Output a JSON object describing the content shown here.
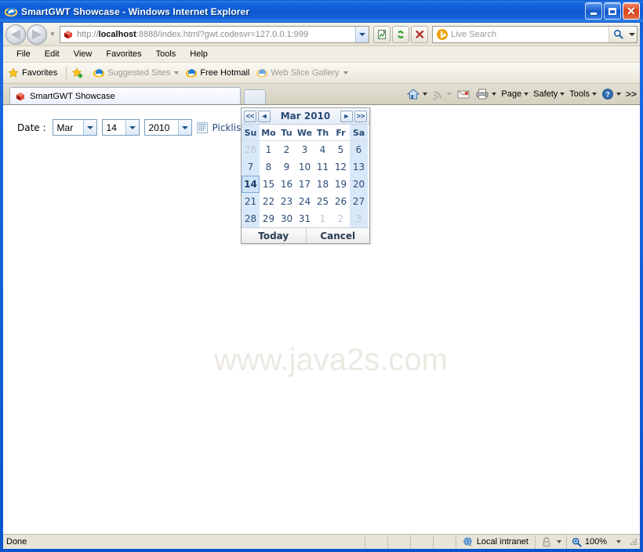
{
  "window": {
    "title": "SmartGWT Showcase - Windows Internet Explorer",
    "icon": "ie-icon",
    "minimize_label": "Minimize",
    "maximize_label": "Maximize",
    "close_label": "Close"
  },
  "navigation": {
    "back_label": "Back",
    "forward_label": "Forward",
    "recent_pages_label": "Recent Pages",
    "url_prefix": "http://",
    "url_host": "localhost",
    "url_rest": ":8888/index.html?gwt.codesvr=127.0.0.1:999",
    "url_full": "http://localhost:8888/index.html?gwt.codesvr=127.0.0.1:999",
    "compatibility_label": "Compatibility View",
    "refresh_label": "Refresh",
    "stop_label": "Stop"
  },
  "search": {
    "placeholder": "Live Search",
    "provider_icon": "bing-icon",
    "go_label": "Search",
    "dropdown_label": "Search options"
  },
  "menubar": {
    "items": [
      {
        "label": "File"
      },
      {
        "label": "Edit"
      },
      {
        "label": "View"
      },
      {
        "label": "Favorites"
      },
      {
        "label": "Tools"
      },
      {
        "label": "Help"
      }
    ]
  },
  "favorites_bar": {
    "favorites_label": "Favorites",
    "items": [
      {
        "label": "Suggested Sites",
        "icon": "ie-icon",
        "dimmed": true,
        "has_dropdown": true
      },
      {
        "label": "Free Hotmail",
        "icon": "ie-icon",
        "dimmed": false,
        "has_dropdown": false
      },
      {
        "label": "Web Slice Gallery",
        "icon": "ie-icon",
        "dimmed": true,
        "has_dropdown": true
      }
    ]
  },
  "tabs": {
    "active": {
      "label": "SmartGWT Showcase",
      "icon": "smartgwt-icon"
    },
    "new_tab_label": "New Tab"
  },
  "command_bar": {
    "home_label": "Home",
    "feeds_label": "Feeds",
    "mail_label": "Read mail",
    "print_label": "Print",
    "items": [
      {
        "label": "Page"
      },
      {
        "label": "Safety"
      },
      {
        "label": "Tools"
      }
    ],
    "help_label": "Help",
    "overflow_label": ">>"
  },
  "page": {
    "watermark": "www.java2s.com",
    "date_form": {
      "label": "Date :",
      "month": {
        "value": "Mar",
        "name": "month-select"
      },
      "day": {
        "value": "14",
        "name": "day-select"
      },
      "year": {
        "value": "2010",
        "name": "year-select"
      },
      "calendar_button_label": "Show Calendar",
      "picklist_text": "Picklist ba"
    },
    "date_chooser": {
      "prev_year_label": "<<",
      "prev_month_label": "◄",
      "title": "Mar 2010",
      "next_month_label": "►",
      "next_year_label": ">>",
      "weekdays": [
        "Su",
        "Mo",
        "Tu",
        "We",
        "Th",
        "Fr",
        "Sa"
      ],
      "weekend_indices": [
        0,
        6
      ],
      "selected_day": 14,
      "weeks": [
        [
          {
            "d": "28",
            "other": true
          },
          {
            "d": "1"
          },
          {
            "d": "2"
          },
          {
            "d": "3"
          },
          {
            "d": "4"
          },
          {
            "d": "5"
          },
          {
            "d": "6"
          }
        ],
        [
          {
            "d": "7"
          },
          {
            "d": "8"
          },
          {
            "d": "9"
          },
          {
            "d": "10"
          },
          {
            "d": "11"
          },
          {
            "d": "12"
          },
          {
            "d": "13"
          }
        ],
        [
          {
            "d": "14",
            "selected": true
          },
          {
            "d": "15"
          },
          {
            "d": "16"
          },
          {
            "d": "17"
          },
          {
            "d": "18"
          },
          {
            "d": "19"
          },
          {
            "d": "20"
          }
        ],
        [
          {
            "d": "21"
          },
          {
            "d": "22"
          },
          {
            "d": "23"
          },
          {
            "d": "24"
          },
          {
            "d": "25"
          },
          {
            "d": "26"
          },
          {
            "d": "27"
          }
        ],
        [
          {
            "d": "28"
          },
          {
            "d": "29"
          },
          {
            "d": "30"
          },
          {
            "d": "31"
          },
          {
            "d": "1",
            "other": true
          },
          {
            "d": "2",
            "other": true
          },
          {
            "d": "3",
            "other": true
          }
        ]
      ],
      "today_label": "Today",
      "cancel_label": "Cancel"
    }
  },
  "status_bar": {
    "status": "Done",
    "zone": "Local intranet",
    "zone_icon": "globe-icon",
    "protected_mode_icon": "lock-icon",
    "zoom": "100%",
    "zoom_icon": "magnifier-icon"
  },
  "colors": {
    "title_blue": "#0D59D2",
    "chrome_beige": "#E8E5D8",
    "weekend_blue": "#D9E8F8",
    "selected_blue": "#CFE3F7",
    "date_text_blue": "#2B4C77",
    "link_blue": "#22497D"
  }
}
